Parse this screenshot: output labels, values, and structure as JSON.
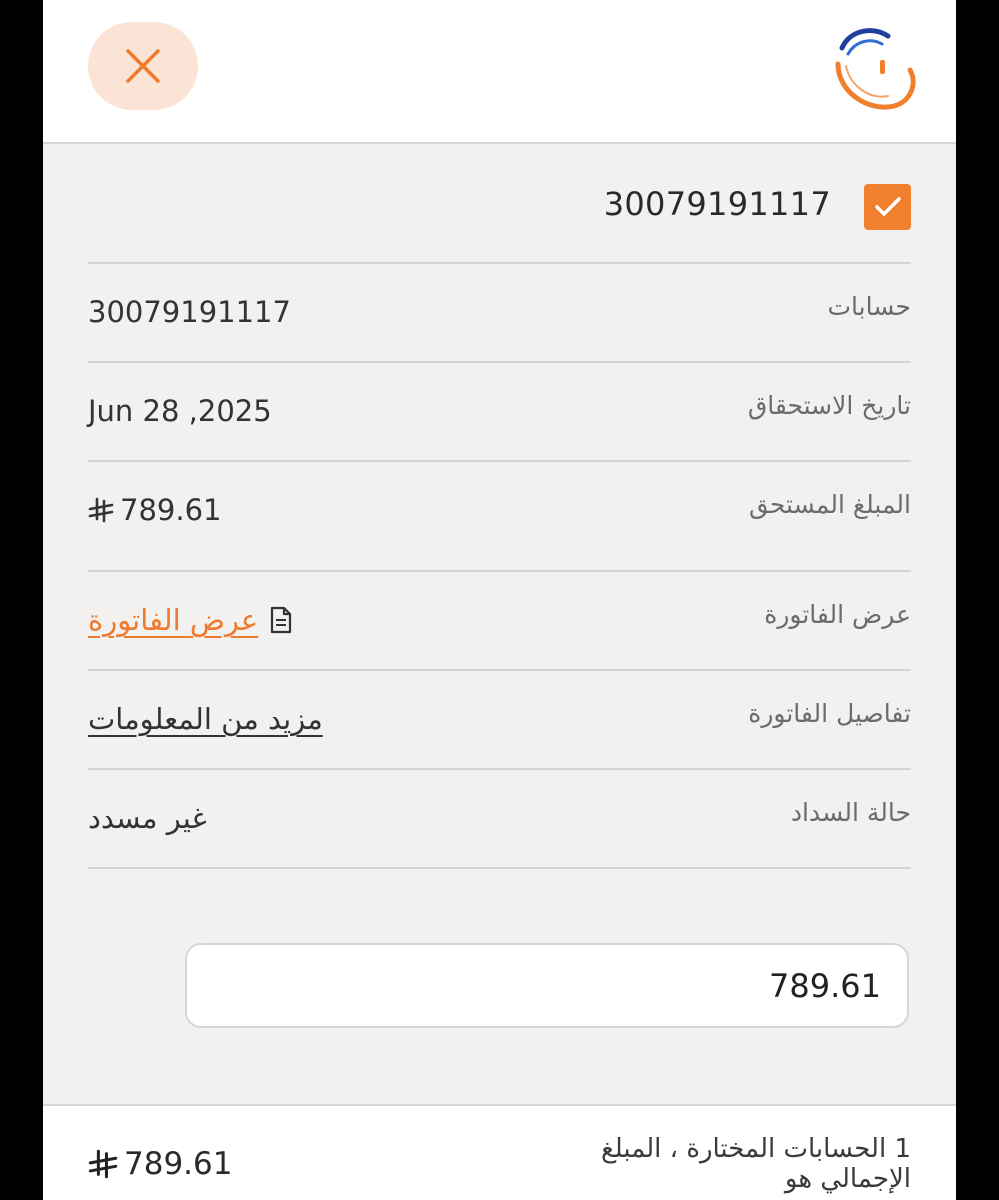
{
  "header": {
    "close_icon": "close-icon",
    "logo_icon": "company-logo"
  },
  "account": {
    "number": "30079191117",
    "selected": true
  },
  "details": {
    "accounts_label": "حسابات",
    "accounts_value": "30079191117",
    "due_date_label": "تاريخ الاستحقاق",
    "due_date_value": "Jun 28 ,2025",
    "amount_due_label": "المبلغ المستحق",
    "amount_due_value": "789.61",
    "view_bill_label": "عرض الفاتورة",
    "view_bill_link": "عرض الفاتورة",
    "bill_details_label": "تفاصيل الفاتورة",
    "bill_details_link": "مزيد من المعلومات",
    "payment_status_label": "حالة السداد",
    "payment_status_value": "غير مسدد"
  },
  "payment": {
    "amount_value": "789.61"
  },
  "footer": {
    "summary_text": "1 الحسابات المختارة ، المبلغ الإجمالي هو",
    "total_value": "789.61"
  },
  "colors": {
    "accent": "#f07f2e",
    "close_bg": "#fbe3d6",
    "content_bg": "#f2f1f0",
    "logo_blue": "#1f3f9c"
  },
  "icons": {
    "currency": "riyal-icon",
    "document": "document-icon",
    "check": "checkmark-icon"
  }
}
